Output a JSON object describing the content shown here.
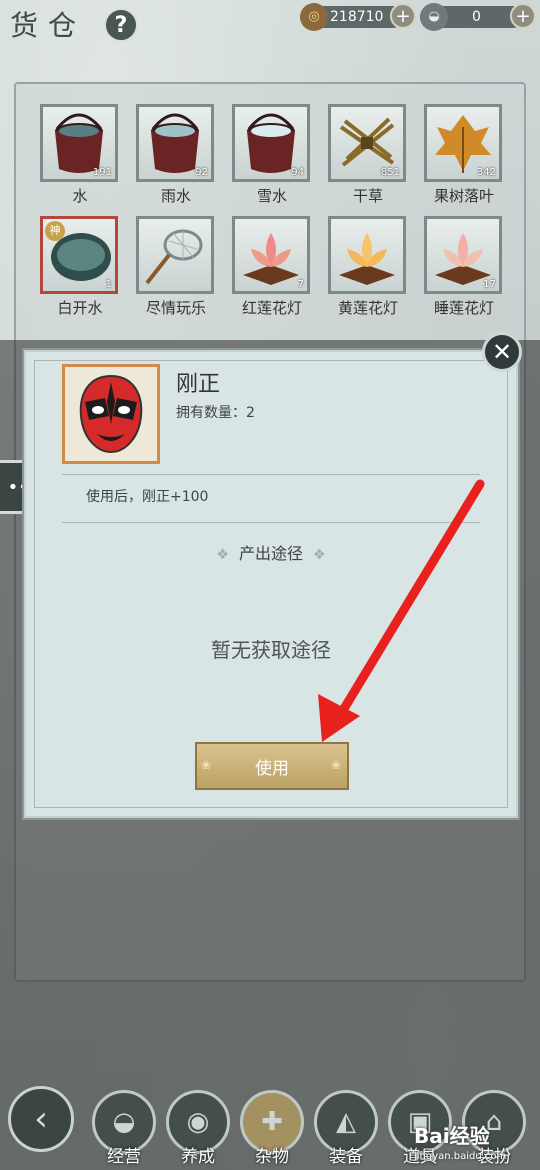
{
  "header": {
    "title": "货仓",
    "help_label": "?",
    "coins": "218710",
    "ingots": "0"
  },
  "items": [
    {
      "label": "水",
      "count": "191"
    },
    {
      "label": "雨水",
      "count": "92"
    },
    {
      "label": "雪水",
      "count": "94"
    },
    {
      "label": "干草",
      "count": "851"
    },
    {
      "label": "果树落叶",
      "count": "342"
    },
    {
      "label": "白开水",
      "count": "1",
      "badge": "神"
    },
    {
      "label": "尽情玩乐",
      "count": ""
    },
    {
      "label": "红莲花灯",
      "count": "7"
    },
    {
      "label": "黄莲花灯",
      "count": ""
    },
    {
      "label": "睡莲花灯",
      "count": "17"
    }
  ],
  "dialog": {
    "close_glyph": "✕",
    "item_name": "刚正",
    "quantity": "拥有数量：2",
    "description": "使用后，刚正+100",
    "section_title": "产出途径",
    "no_source": "暂无获取途径",
    "use_button": "使用"
  },
  "nav": {
    "tabs": [
      {
        "label": "经营"
      },
      {
        "label": "养成"
      },
      {
        "label": "杂物"
      },
      {
        "label": "装备"
      },
      {
        "label": "道具"
      },
      {
        "label": "装扮"
      }
    ]
  },
  "watermark": {
    "brand": "Bai经验",
    "url": "jingyan.baidu.com"
  },
  "colors": {
    "annotation_arrow": "#e8201e",
    "button_gold": "#c9ae72"
  }
}
